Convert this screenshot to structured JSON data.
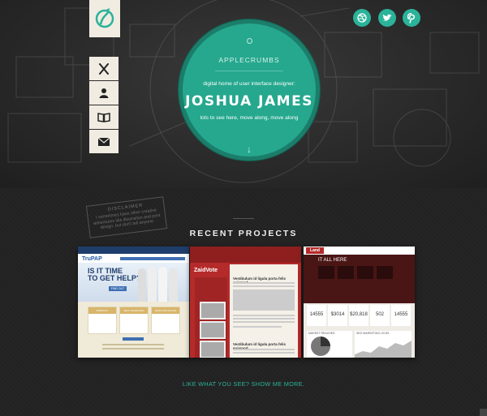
{
  "hero": {
    "brand": "APPLECRUMBS",
    "tagline": "digital home of user interface designer:",
    "name": "JOSHUA JAMES",
    "subtitle": "lots to see here, move along, move along",
    "scroll_arrow": "↓"
  },
  "side_nav": {
    "items": [
      {
        "icon": "utensils-icon"
      },
      {
        "icon": "person-icon"
      },
      {
        "icon": "book-icon"
      },
      {
        "icon": "envelope-icon"
      }
    ]
  },
  "social": [
    {
      "icon": "dribbble-icon"
    },
    {
      "icon": "twitter-icon"
    },
    {
      "icon": "pinterest-icon"
    }
  ],
  "disclaimer": {
    "title": "DISCLAIMER",
    "text": "I sometimes have other creative adventures like illustration and print design, but don't tell anyone."
  },
  "recent_projects": {
    "title": "RECENT PROJECTS",
    "projects": [
      {
        "brand": "TruPAP",
        "headline_1": "IS IT TIME",
        "headline_2": "TO GET HELP?",
        "button": "FIND OUT",
        "cards": [
          "PRODUCT COMPARISON",
          "SELF DIAGNOSIS",
          "FIND A PHYSICIAN"
        ]
      },
      {
        "brand": "ZaidVote",
        "heading_1": "Vestibulum id ligula porta felis euismod",
        "heading_2": "Vestibulum id ligula porta felis euismod"
      },
      {
        "brand": "Land",
        "headline": "IT ALL HERE",
        "stats": [
          "14555",
          "$3014",
          "$20,818",
          "502",
          "14555"
        ],
        "panel_1": "MARKET REACHED",
        "panel_2": "SEO MARKETING LEVEL"
      }
    ]
  },
  "show_more": "LIKE WHAT YOU SEE? SHOW ME MORE.",
  "colors": {
    "accent": "#2bb39a",
    "circle": "#25a88e",
    "cream": "#f1ece2",
    "red": "#b22a2a"
  }
}
